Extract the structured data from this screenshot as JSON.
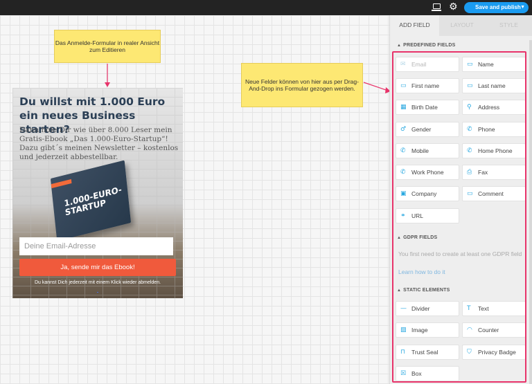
{
  "topbar": {
    "publish_label": "Save and publish",
    "icons": [
      "monitor-icon",
      "gear-icon",
      "chevron-down-icon"
    ],
    "accent_color": "#1a9bf0"
  },
  "canvas": {
    "note_form": "Das Anmelde-Formular in realer Ansicht zum Editieren",
    "note_fields": "Neue Felder können von hier aus per Drag-And-Drop ins Formular gezogen werden."
  },
  "form": {
    "headline": "Du willst mit 1.000 Euro ein neues Business starten?",
    "subtext": "Dann hole Dir wie über 8.000 Leser mein Gratis-Ebook „Das 1.000-Euro-Startup“! Dazu gibt´s meinen Newsletter – kostenlos und jederzeit abbestellbar.",
    "ebook_title": "1.000-EURO-STARTUP",
    "email_placeholder": "Deine Email-Adresse",
    "submit_label": "Ja, sende mir das Ebook!",
    "footer_text": "Du kannst Dich jederzeit mit einem Klick wieder abmelden.",
    "button_color": "#f05a3c"
  },
  "panel": {
    "tabs": [
      "ADD FIELD",
      "LAYOUT",
      "STYLE"
    ],
    "predefined_title": "PREDEFINED FIELDS",
    "predefined_fields": [
      {
        "label": "Email",
        "icon": "envelope-icon"
      },
      {
        "label": "Name",
        "icon": "id-card-icon"
      },
      {
        "label": "First name",
        "icon": "text-field-icon"
      },
      {
        "label": "Last name",
        "icon": "text-field-icon"
      },
      {
        "label": "Birth Date",
        "icon": "calendar-icon"
      },
      {
        "label": "Address",
        "icon": "map-pin-icon"
      },
      {
        "label": "Gender",
        "icon": "gender-icon"
      },
      {
        "label": "Phone",
        "icon": "phone-icon"
      },
      {
        "label": "Mobile",
        "icon": "phone-icon"
      },
      {
        "label": "Home Phone",
        "icon": "phone-icon"
      },
      {
        "label": "Work Phone",
        "icon": "phone-icon"
      },
      {
        "label": "Fax",
        "icon": "fax-icon"
      },
      {
        "label": "Company",
        "icon": "briefcase-icon"
      },
      {
        "label": "Comment",
        "icon": "comment-icon"
      },
      {
        "label": "URL",
        "icon": "link-icon"
      }
    ],
    "gdpr_title": "GDPR FIELDS",
    "gdpr_message": "You first need to create at least one GDPR field",
    "gdpr_link": "Learn how to do it",
    "static_title": "STATIC ELEMENTS",
    "static_elements": [
      {
        "label": "Divider",
        "icon": "divider-icon"
      },
      {
        "label": "Text",
        "icon": "text-icon"
      },
      {
        "label": "Image",
        "icon": "image-icon"
      },
      {
        "label": "Counter",
        "icon": "gauge-icon"
      },
      {
        "label": "Trust Seal",
        "icon": "lock-icon"
      },
      {
        "label": "Privacy Badge",
        "icon": "shield-icon"
      },
      {
        "label": "Box",
        "icon": "box-icon"
      }
    ],
    "highlight_color": "#e8336a"
  }
}
